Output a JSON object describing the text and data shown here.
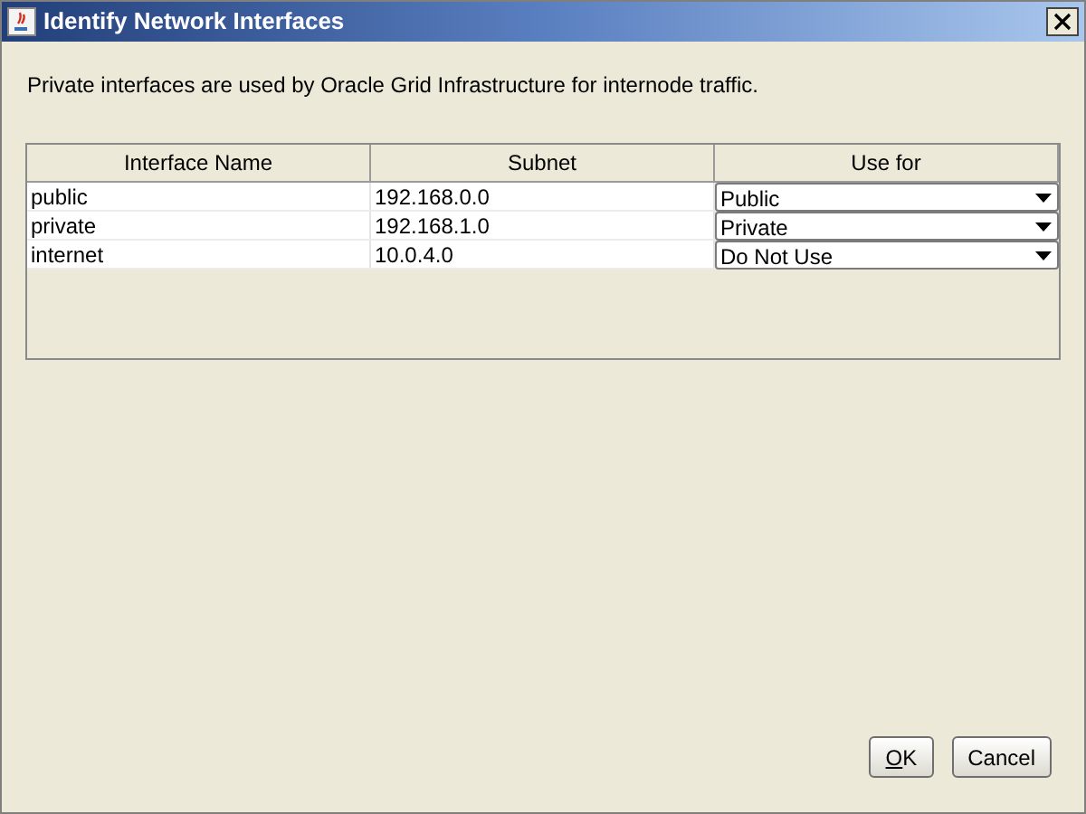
{
  "window": {
    "title": "Identify Network Interfaces"
  },
  "description": "Private interfaces are used by Oracle Grid Infrastructure for internode traffic.",
  "table": {
    "columns": [
      "Interface Name",
      "Subnet",
      "Use for"
    ],
    "rows": [
      {
        "interface_name": "public",
        "subnet": "192.168.0.0",
        "use_for": "Public"
      },
      {
        "interface_name": "private",
        "subnet": "192.168.1.0",
        "use_for": "Private"
      },
      {
        "interface_name": "internet",
        "subnet": "10.0.4.0",
        "use_for": "Do Not Use"
      }
    ]
  },
  "buttons": [
    {
      "label": "OK",
      "mnemonic_underlined": true
    },
    {
      "label": "Cancel"
    }
  ]
}
